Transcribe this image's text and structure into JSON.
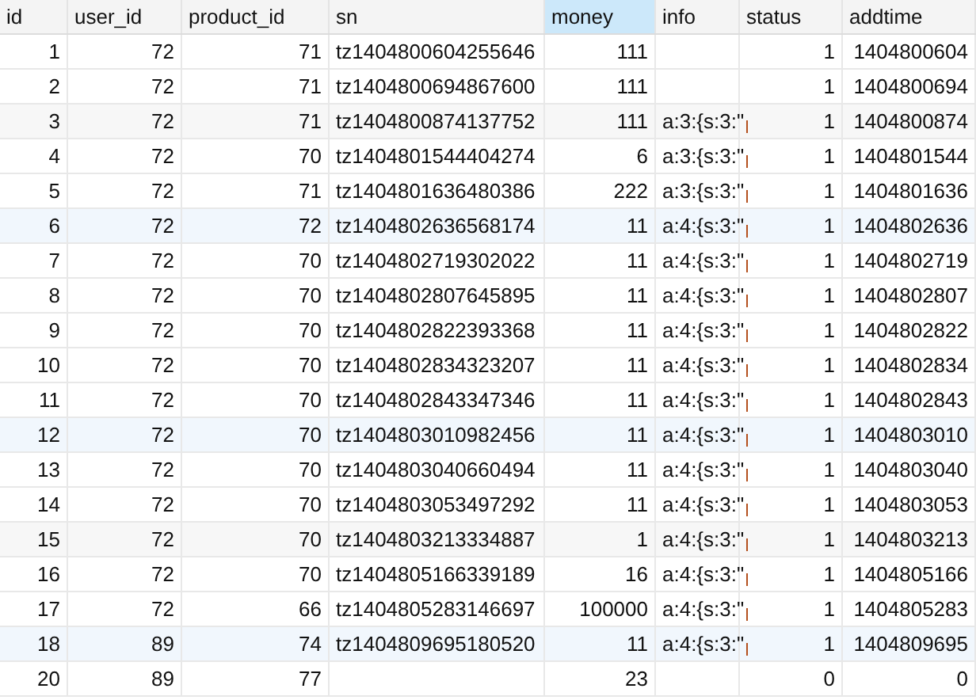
{
  "table": {
    "columns": [
      {
        "label": "id",
        "selected": false
      },
      {
        "label": "user_id",
        "selected": false
      },
      {
        "label": "product_id",
        "selected": false
      },
      {
        "label": "sn",
        "selected": false
      },
      {
        "label": "money",
        "selected": true
      },
      {
        "label": "info",
        "selected": false
      },
      {
        "label": "status",
        "selected": false
      },
      {
        "label": "addtime",
        "selected": false
      }
    ],
    "rows": [
      {
        "color": "#ffffff",
        "cells": [
          "1",
          "72",
          "71",
          "tz1404800604255646",
          "111",
          "",
          "1",
          "1404800604"
        ],
        "truncated": false
      },
      {
        "color": "#ffffff",
        "cells": [
          "2",
          "72",
          "71",
          "tz1404800694867600",
          "111",
          "",
          "1",
          "1404800694"
        ],
        "truncated": false
      },
      {
        "color": "#f7f7f7",
        "cells": [
          "3",
          "72",
          "71",
          "tz1404800874137752",
          "111",
          "a:3:{s:3:\"",
          "1",
          "1404800874"
        ],
        "truncated": true
      },
      {
        "color": "#ffffff",
        "cells": [
          "4",
          "72",
          "70",
          "tz1404801544404274",
          "6",
          "a:3:{s:3:\"",
          "1",
          "1404801544"
        ],
        "truncated": true
      },
      {
        "color": "#ffffff",
        "cells": [
          "5",
          "72",
          "71",
          "tz1404801636480386",
          "222",
          "a:3:{s:3:\"",
          "1",
          "1404801636"
        ],
        "truncated": true
      },
      {
        "color": "#f1f7fd",
        "cells": [
          "6",
          "72",
          "72",
          "tz1404802636568174",
          "11",
          "a:4:{s:3:\"",
          "1",
          "1404802636"
        ],
        "truncated": true
      },
      {
        "color": "#ffffff",
        "cells": [
          "7",
          "72",
          "70",
          "tz1404802719302022",
          "11",
          "a:4:{s:3:\"",
          "1",
          "1404802719"
        ],
        "truncated": true
      },
      {
        "color": "#ffffff",
        "cells": [
          "8",
          "72",
          "70",
          "tz1404802807645895",
          "11",
          "a:4:{s:3:\"",
          "1",
          "1404802807"
        ],
        "truncated": true
      },
      {
        "color": "#ffffff",
        "cells": [
          "9",
          "72",
          "70",
          "tz1404802822393368",
          "11",
          "a:4:{s:3:\"",
          "1",
          "1404802822"
        ],
        "truncated": true
      },
      {
        "color": "#ffffff",
        "cells": [
          "10",
          "72",
          "70",
          "tz1404802834323207",
          "11",
          "a:4:{s:3:\"",
          "1",
          "1404802834"
        ],
        "truncated": true
      },
      {
        "color": "#ffffff",
        "cells": [
          "11",
          "72",
          "70",
          "tz1404802843347346",
          "11",
          "a:4:{s:3:\"",
          "1",
          "1404802843"
        ],
        "truncated": true
      },
      {
        "color": "#f1f7fd",
        "cells": [
          "12",
          "72",
          "70",
          "tz1404803010982456",
          "11",
          "a:4:{s:3:\"",
          "1",
          "1404803010"
        ],
        "truncated": true
      },
      {
        "color": "#ffffff",
        "cells": [
          "13",
          "72",
          "70",
          "tz1404803040660494",
          "11",
          "a:4:{s:3:\"",
          "1",
          "1404803040"
        ],
        "truncated": true
      },
      {
        "color": "#ffffff",
        "cells": [
          "14",
          "72",
          "70",
          "tz1404803053497292",
          "11",
          "a:4:{s:3:\"",
          "1",
          "1404803053"
        ],
        "truncated": true
      },
      {
        "color": "#f7f7f7",
        "cells": [
          "15",
          "72",
          "70",
          "tz1404803213334887",
          "1",
          "a:4:{s:3:\"",
          "1",
          "1404803213"
        ],
        "truncated": true
      },
      {
        "color": "#ffffff",
        "cells": [
          "16",
          "72",
          "70",
          "tz1404805166339189",
          "16",
          "a:4:{s:3:\"",
          "1",
          "1404805166"
        ],
        "truncated": true
      },
      {
        "color": "#ffffff",
        "cells": [
          "17",
          "72",
          "66",
          "tz1404805283146697",
          "100000",
          "a:4:{s:3:\"",
          "1",
          "1404805283"
        ],
        "truncated": true
      },
      {
        "color": "#f1f7fd",
        "cells": [
          "18",
          "89",
          "74",
          "tz1404809695180520",
          "11",
          "a:4:{s:3:\"",
          "1",
          "1404809695"
        ],
        "truncated": true
      },
      {
        "color": "#ffffff",
        "cells": [
          "20",
          "89",
          "77",
          "",
          "23",
          "",
          "0",
          "0"
        ],
        "truncated": false
      }
    ]
  }
}
